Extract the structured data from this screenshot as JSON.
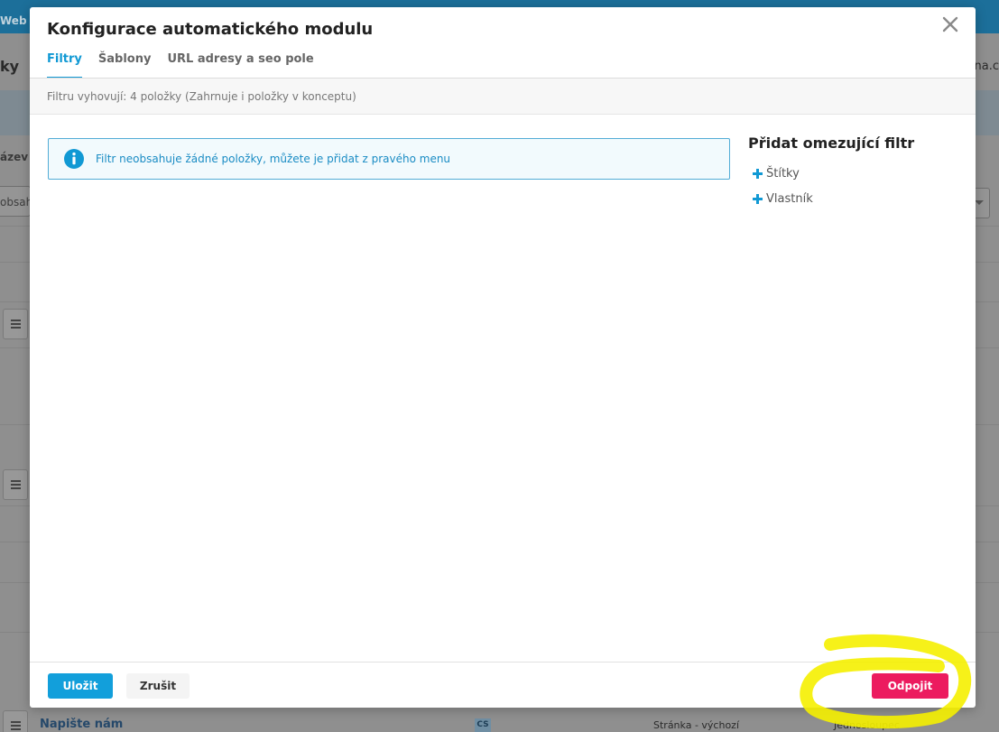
{
  "background": {
    "top_tab": "Web",
    "heading": "ky",
    "domain": "na.c",
    "column_header": "ázev",
    "filter_text": "obsah",
    "row": {
      "name": "Napište nám",
      "lang": "CS",
      "template": "Stránka - výchozí",
      "layout": "Jednosloupec"
    }
  },
  "modal": {
    "title": "Konfigurace automatického modulu",
    "close_icon": "close-icon",
    "tabs": [
      {
        "label": "Filtry",
        "active": true
      },
      {
        "label": "Šablony",
        "active": false
      },
      {
        "label": "URL adresy a seo pole",
        "active": false
      }
    ],
    "counter": "Filtru vyhovují: 4 položky (Zahrnuje i položky v konceptu)",
    "info": {
      "icon": "info-icon",
      "text": "Filtr neobsahuje žádné položky, můžete je přidat z pravého menu"
    },
    "side": {
      "title": "Přidat omezující filtr",
      "items": [
        {
          "label": "Štítky",
          "icon": "plus-icon"
        },
        {
          "label": "Vlastník",
          "icon": "plus-icon"
        }
      ]
    },
    "footer": {
      "save": "Uložit",
      "cancel": "Zrušit",
      "detach": "Odpojit"
    }
  },
  "colors": {
    "accent": "#1199d4",
    "danger": "#ec1b5f",
    "highlight": "#f5f000"
  }
}
